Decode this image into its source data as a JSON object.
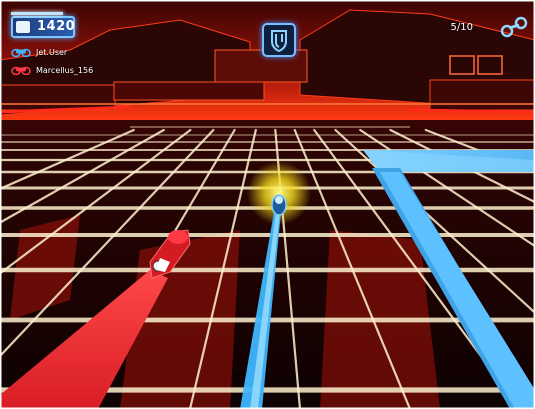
{
  "hud": {
    "score": "1420",
    "lap_counter": "5/10",
    "players": [
      {
        "name": "Jet.User",
        "icon": "blue-lightcycle-icon"
      },
      {
        "name": "Marcellus_156",
        "icon": "red-lightcycle-icon"
      }
    ],
    "team_emblem_icon": "blue-shield-emblem-icon",
    "lap_icon": "blue-lightcycle-icon"
  },
  "colors": {
    "player_blue": "#3fb6ff",
    "enemy_red": "#ff2d3a",
    "grid_glow": "#fff6d8",
    "floor_dark": "#120404",
    "arena_red": "#b0160f"
  }
}
